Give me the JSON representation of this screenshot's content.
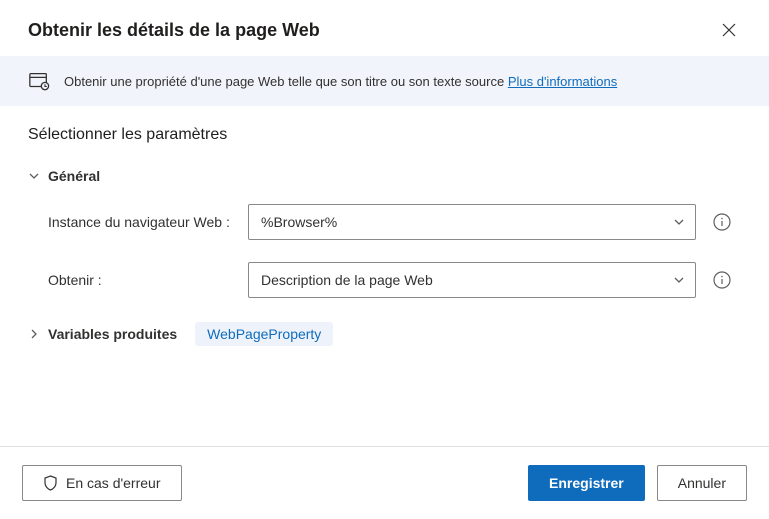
{
  "header": {
    "title": "Obtenir les détails de la page Web"
  },
  "banner": {
    "text": "Obtenir une propriété d'une page Web telle que son titre ou son texte source ",
    "link_label": "Plus d'informations"
  },
  "content": {
    "section_title": "Sélectionner les paramètres",
    "general": {
      "label": "Général",
      "browser_instance": {
        "label": "Instance du navigateur Web :",
        "value": "%Browser%"
      },
      "get": {
        "label": "Obtenir :",
        "value": "Description de la page Web"
      }
    },
    "variables": {
      "label": "Variables produites",
      "chip": "WebPageProperty"
    }
  },
  "footer": {
    "on_error": "En cas d'erreur",
    "save": "Enregistrer",
    "cancel": "Annuler"
  }
}
